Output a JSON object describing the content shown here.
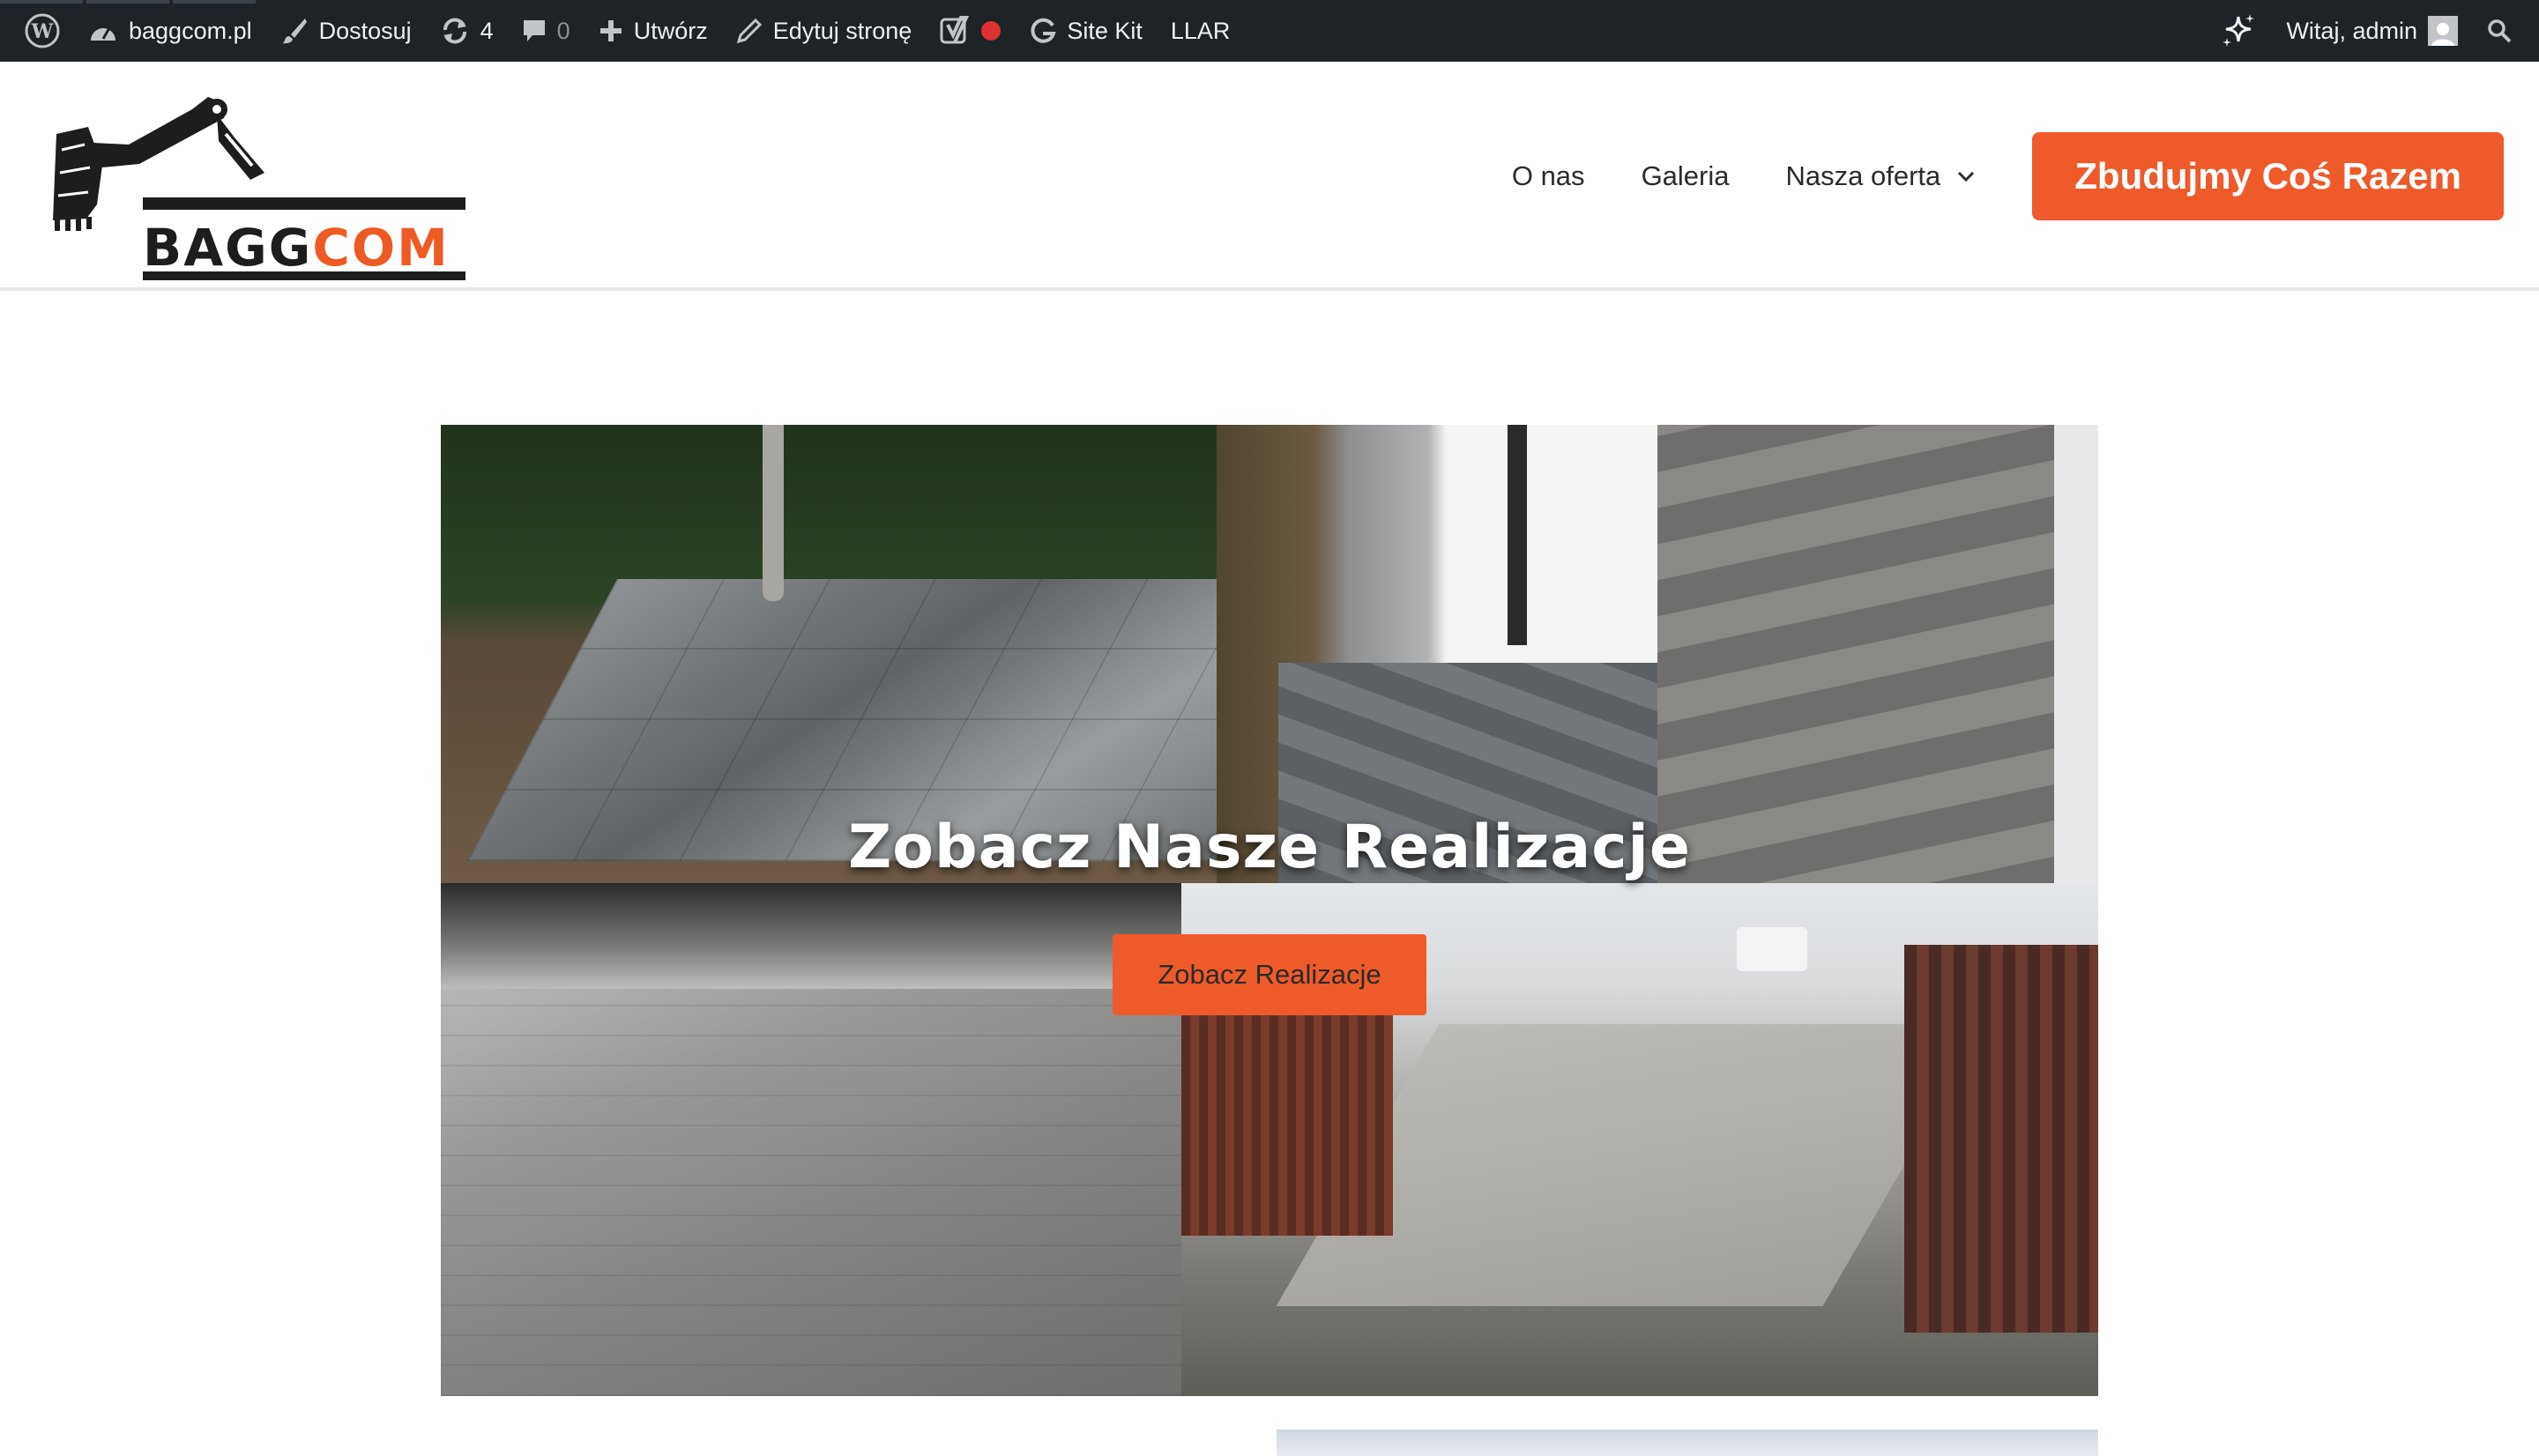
{
  "admin_bar": {
    "site_name": "baggcom.pl",
    "customize": "Dostosuj",
    "updates_count": "4",
    "comments_count": "0",
    "create": "Utwórz",
    "edit_page": "Edytuj stronę",
    "site_kit": "Site Kit",
    "llar": "LLAR",
    "greeting": "Witaj, admin"
  },
  "logo": {
    "word_dark": "BAGG",
    "word_accent": "COM"
  },
  "nav": {
    "items": [
      "O nas",
      "Galeria",
      "Nasza oferta"
    ],
    "cta": "Zbudujmy Coś Razem"
  },
  "hero": {
    "title": "Zobacz Nasze Realizacje",
    "button": "Zobacz Realizacje"
  },
  "colors": {
    "accent": "#ef5a2b",
    "admin_bar": "#1d2327"
  }
}
